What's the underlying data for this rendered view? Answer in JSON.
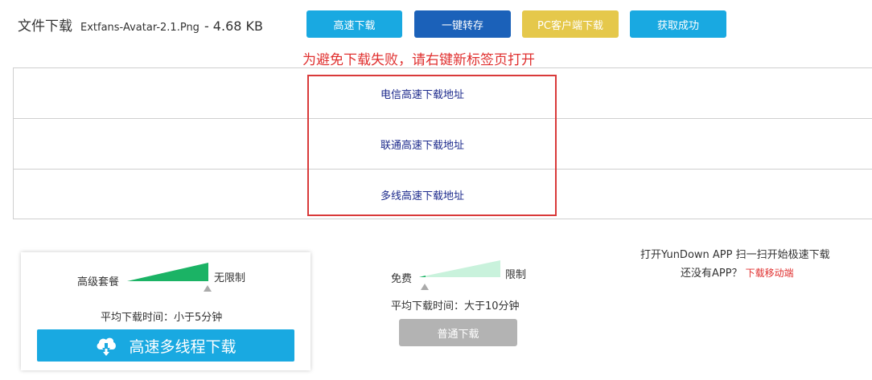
{
  "header": {
    "file_label": "文件下载",
    "file_name": "Extfans-Avatar-2.1.Png",
    "file_size": "- 4.68 KB"
  },
  "buttons": {
    "high_speed": "高速下载",
    "one_click_save": "一键转存",
    "pc_client": "PC客户端下载",
    "get_success": "获取成功"
  },
  "colors": {
    "primary_blue": "#19a9e1",
    "dark_blue": "#1b61b9",
    "yellow": "#e5c84b",
    "warning_red": "#e0302f",
    "premium_green": "#1bb365",
    "free_green": "#c9f2dc",
    "gray_button": "#b3b3b3"
  },
  "warning_text": "为避免下载失败，请右键新标签页打开",
  "links": [
    {
      "label": "电信高速下载地址"
    },
    {
      "label": "联通高速下载地址"
    },
    {
      "label": "多线高速下载地址"
    }
  ],
  "premium": {
    "left_label": "高级套餐",
    "right_label": "无限制",
    "avg_time": "平均下载时间：小于5分钟",
    "button_label": "高速多线程下载",
    "button_icon": "cloud-download-icon"
  },
  "free": {
    "left_label": "免费",
    "right_label": "限制",
    "avg_time": "平均下载时间：大于10分钟",
    "button_label": "普通下载"
  },
  "app": {
    "line1": "打开YunDown APP 扫一扫开始极速下载",
    "line2": "还没有APP？",
    "mobile_link": "下载移动端"
  }
}
